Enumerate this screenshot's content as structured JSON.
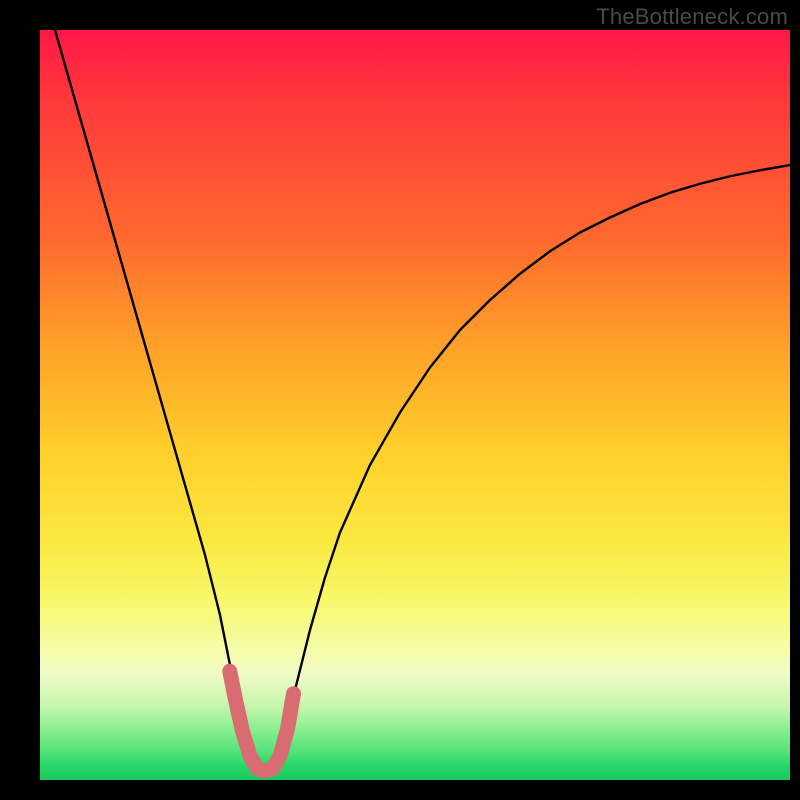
{
  "watermark": "TheBottleneck.com",
  "colors": {
    "curve": "#000000",
    "highlight": "#d96b72",
    "frame": "#000000"
  },
  "chart_data": {
    "type": "line",
    "title": "",
    "xlabel": "",
    "ylabel": "",
    "xlim": [
      0,
      100
    ],
    "ylim": [
      0,
      100
    ],
    "grid": false,
    "series": [
      {
        "name": "bottleneck_curve",
        "x": [
          2,
          4,
          6,
          8,
          10,
          12,
          14,
          16,
          18,
          20,
          22,
          23,
          24,
          25,
          26,
          27,
          28,
          29,
          30,
          31,
          32,
          33,
          34,
          36,
          38,
          40,
          44,
          48,
          52,
          56,
          60,
          64,
          68,
          72,
          76,
          80,
          84,
          88,
          92,
          96,
          100
        ],
        "y": [
          100,
          93,
          86,
          79,
          72,
          65,
          58,
          51,
          44,
          37,
          30,
          26,
          22,
          17,
          12,
          7,
          3,
          1.2,
          1,
          1.2,
          3,
          7,
          12,
          20,
          27,
          33,
          42,
          49,
          55,
          60,
          64,
          67.5,
          70.5,
          73,
          75,
          76.8,
          78.3,
          79.5,
          80.5,
          81.3,
          82
        ]
      },
      {
        "name": "bottleneck_highlight",
        "x": [
          25.3,
          26,
          27,
          28,
          29,
          30,
          31,
          32,
          33,
          33.8
        ],
        "y": [
          14.5,
          11,
          6.5,
          3.2,
          1.5,
          1.2,
          1.5,
          3.2,
          6.8,
          11.5
        ]
      }
    ],
    "gradient_stops": [
      {
        "pos": 0.0,
        "color": "#ff1846"
      },
      {
        "pos": 0.1,
        "color": "#ff3a3a"
      },
      {
        "pos": 0.28,
        "color": "#ff6a2e"
      },
      {
        "pos": 0.42,
        "color": "#ffa029"
      },
      {
        "pos": 0.56,
        "color": "#ffcf2a"
      },
      {
        "pos": 0.68,
        "color": "#fbe83f"
      },
      {
        "pos": 0.76,
        "color": "#f7f86a"
      },
      {
        "pos": 0.82,
        "color": "#f6fca2"
      },
      {
        "pos": 0.86,
        "color": "#f0fcc7"
      },
      {
        "pos": 0.9,
        "color": "#c7f6ae"
      },
      {
        "pos": 0.93,
        "color": "#8ef093"
      },
      {
        "pos": 0.96,
        "color": "#58e47a"
      },
      {
        "pos": 0.98,
        "color": "#28d768"
      },
      {
        "pos": 1.0,
        "color": "#18c95d"
      }
    ]
  }
}
